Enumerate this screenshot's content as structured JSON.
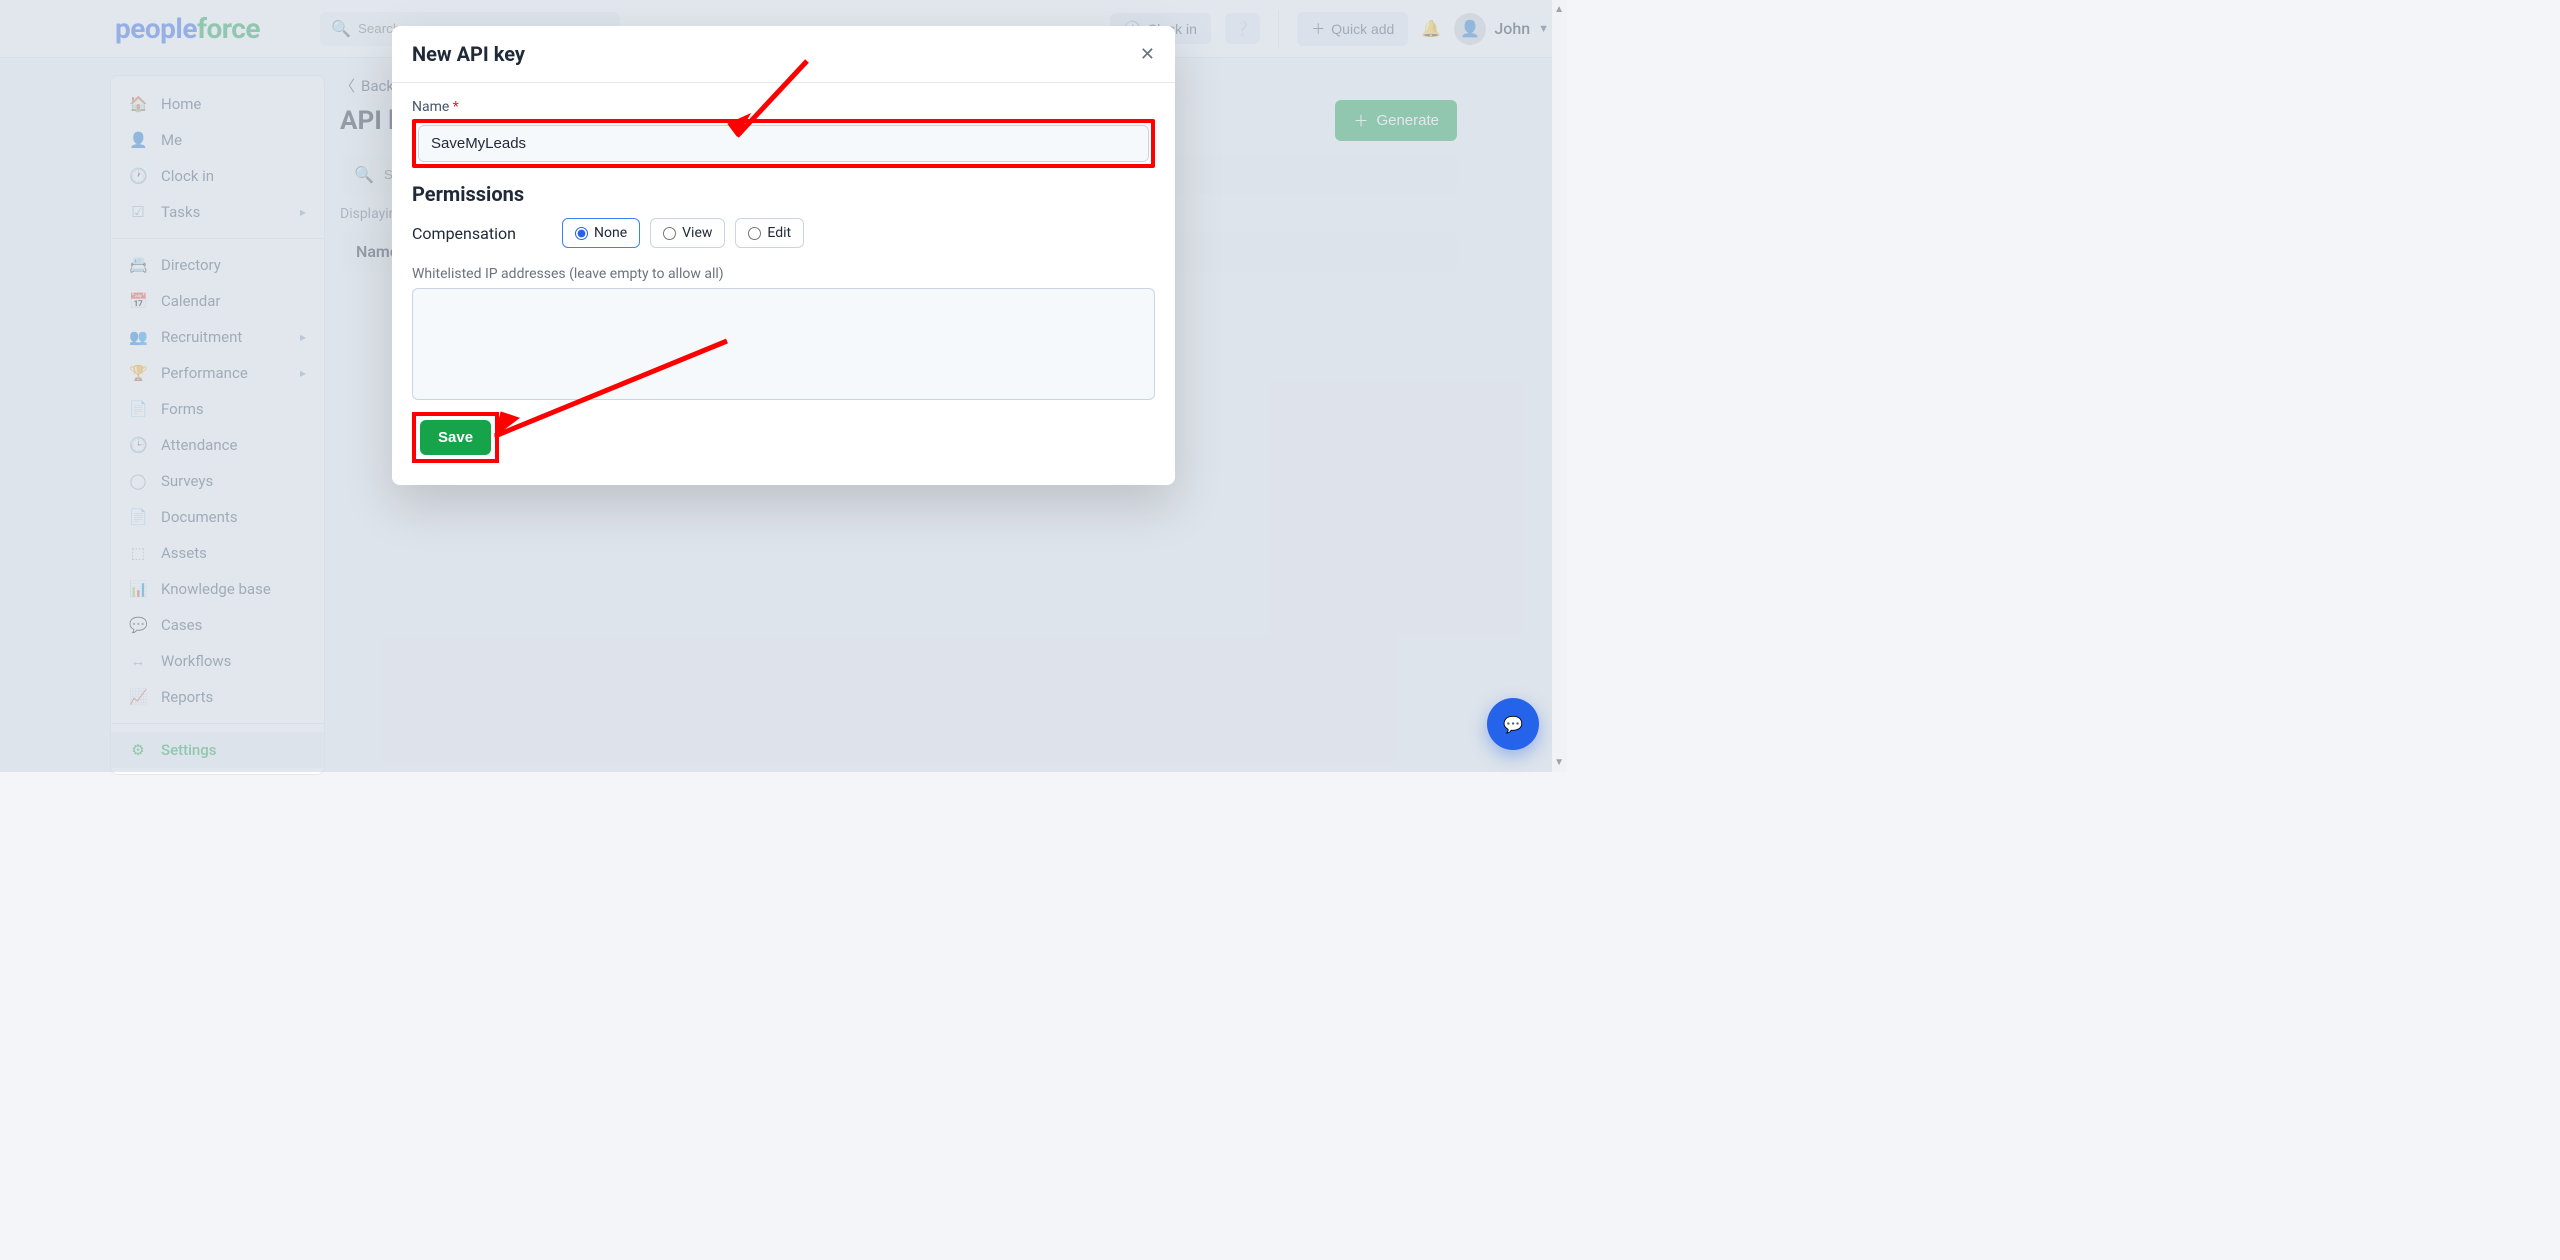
{
  "logo": {
    "part1": "people",
    "part2": "force"
  },
  "top": {
    "search_placeholder": "Search",
    "clockin": "Clock in",
    "quickadd": "Quick add",
    "user": "John"
  },
  "sidebar": {
    "items": [
      {
        "label": "Home",
        "icon": "🏠"
      },
      {
        "label": "Me",
        "icon": "👤"
      },
      {
        "label": "Clock in",
        "icon": "🕐"
      },
      {
        "label": "Tasks",
        "icon": "☑",
        "sub": true
      },
      {
        "sep": true
      },
      {
        "label": "Directory",
        "icon": "📇"
      },
      {
        "label": "Calendar",
        "icon": "📅"
      },
      {
        "label": "Recruitment",
        "icon": "👥",
        "sub": true
      },
      {
        "label": "Performance",
        "icon": "🏆",
        "sub": true
      },
      {
        "label": "Forms",
        "icon": "📄"
      },
      {
        "label": "Attendance",
        "icon": "🕒"
      },
      {
        "label": "Surveys",
        "icon": "◯"
      },
      {
        "label": "Documents",
        "icon": "📄"
      },
      {
        "label": "Assets",
        "icon": "⬚"
      },
      {
        "label": "Knowledge base",
        "icon": "📊"
      },
      {
        "label": "Cases",
        "icon": "💬"
      },
      {
        "label": "Workflows",
        "icon": "↔"
      },
      {
        "label": "Reports",
        "icon": "📈"
      },
      {
        "sep": true
      },
      {
        "label": "Settings",
        "icon": "⚙",
        "active": true
      }
    ]
  },
  "page": {
    "back": "Back",
    "title": "API keys",
    "generate": "Generate",
    "search_placeholder": "Search",
    "displaying": "Displaying",
    "col_name": "Name"
  },
  "modal": {
    "title": "New API key",
    "name_label": "Name",
    "name_value": "SaveMyLeads",
    "perm_heading": "Permissions",
    "perm_row": "Compensation",
    "opt_none": "None",
    "opt_view": "View",
    "opt_edit": "Edit",
    "whitelist_label": "Whitelisted IP addresses (leave empty to allow all)",
    "save": "Save"
  }
}
